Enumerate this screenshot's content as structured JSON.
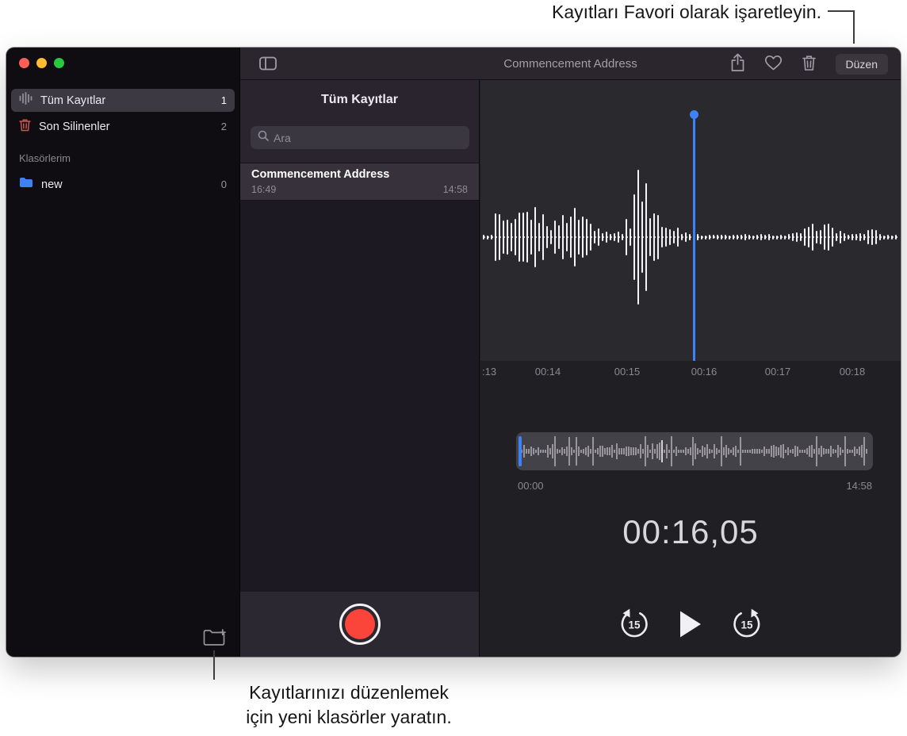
{
  "annotations": {
    "top": "Kayıtları Favori olarak işaretleyin.",
    "bottom_line1": "Kayıtlarınızı düzenlemek",
    "bottom_line2": "için yeni klasörler yaratın."
  },
  "toolbar": {
    "title": "Commencement Address",
    "edit_button": "Düzen"
  },
  "sidebar": {
    "items": [
      {
        "label": "Tüm Kayıtlar",
        "count": "1"
      },
      {
        "label": "Son Silinenler",
        "count": "2"
      }
    ],
    "section_header": "Klasörlerim",
    "folders": [
      {
        "label": "new",
        "count": "0"
      }
    ]
  },
  "recordings_list": {
    "header": "Tüm Kayıtlar",
    "search_placeholder": "Ara",
    "items": [
      {
        "title": "Commencement Address",
        "time": "16:49",
        "duration": "14:58"
      }
    ]
  },
  "player": {
    "timeline_labels": [
      ":13",
      "00:14",
      "00:15",
      "00:16",
      "00:17",
      "00:18"
    ],
    "scrubber_start": "00:00",
    "scrubber_end": "14:58",
    "current_time": "00:16,05",
    "skip_back_label": "15",
    "skip_forward_label": "15"
  },
  "colors": {
    "accent_blue": "#3f82f8",
    "record_red": "#fc453a",
    "traffic_red": "#ff5f57",
    "traffic_yellow": "#febc2e",
    "traffic_green": "#28c840"
  }
}
